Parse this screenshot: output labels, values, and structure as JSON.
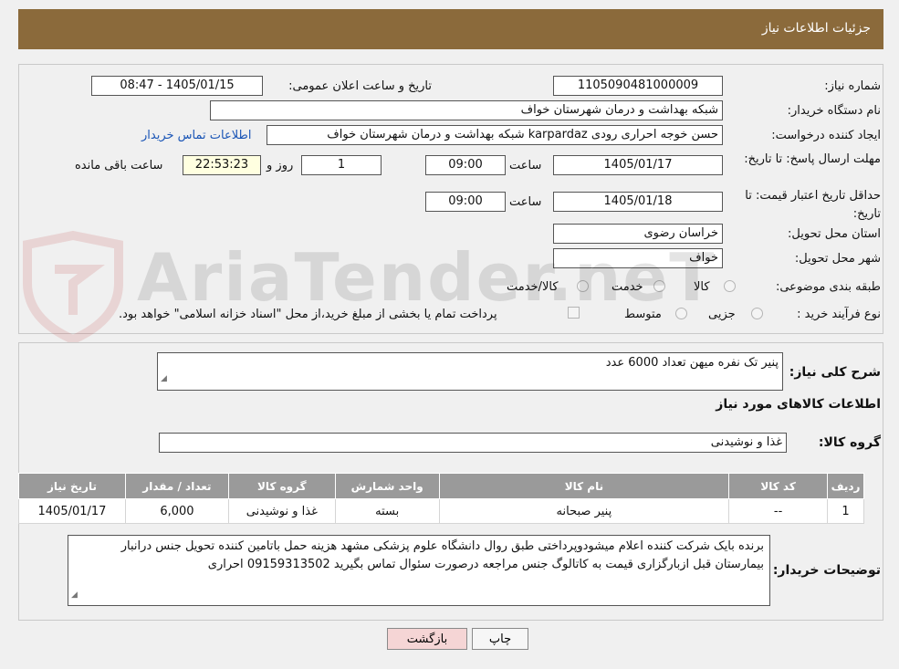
{
  "header": {
    "title": "جزئیات اطلاعات نیاز"
  },
  "form": {
    "need_number_label": "شماره نیاز:",
    "need_number": "1105090481000009",
    "announce_label": "تاریخ و ساعت اعلان عمومی:",
    "announce_value": "1405/01/15 - 08:47",
    "buyer_org_label": "نام دستگاه خریدار:",
    "buyer_org": "شبکه بهداشت و درمان شهرستان خواف",
    "creator_label": "ایجاد کننده درخواست:",
    "creator": "حسن خوجه احراری رودی karpardaz شبکه بهداشت و درمان شهرستان خواف",
    "contact_link": "اطلاعات تماس خریدار",
    "deadline_label": "مهلت ارسال پاسخ: تا تاریخ:",
    "deadline_date": "1405/01/17",
    "time_label": "ساعت",
    "deadline_time": "09:00",
    "days_value": "1",
    "days_label": "روز و",
    "remaining_time": "22:53:23",
    "remaining_label": "ساعت باقی مانده",
    "validity_label": "حداقل تاریخ اعتبار قیمت: تا تاریخ:",
    "validity_date": "1405/01/18",
    "validity_time": "09:00",
    "province_label": "استان محل تحویل:",
    "province": "خراسان رضوی",
    "city_label": "شهر محل تحویل:",
    "city": "خواف",
    "category_label": "طبقه بندی موضوعی:",
    "category_options": [
      "کالا",
      "خدمت",
      "کالا/خدمت"
    ],
    "category_selected": "کالا",
    "process_label": "نوع فرآیند خرید :",
    "process_options": [
      "جزیی",
      "متوسط"
    ],
    "payment_note": "پرداخت تمام یا بخشی از مبلغ خرید،از محل \"اسناد خزانه اسلامی\" خواهد بود."
  },
  "description": {
    "label": "شرح کلی نیاز:",
    "value": "پنیر تک نفره میهن تعداد 6000 عدد"
  },
  "goods": {
    "section_title": "اطلاعات کالاهای مورد نیاز",
    "group_label": "گروه کالا:",
    "group_value": "غذا و نوشیدنی",
    "columns": [
      "ردیف",
      "کد کالا",
      "نام کالا",
      "واحد شمارش",
      "گروه کالا",
      "تعداد / مقدار",
      "تاریخ نیاز"
    ],
    "rows": [
      [
        "1",
        "--",
        "پنیر صبحانه",
        "بسته",
        "غذا و نوشیدنی",
        "6,000",
        "1405/01/17"
      ]
    ]
  },
  "buyer_notes": {
    "label": "توضیحات خریدار:",
    "value": "برنده بایک شرکت کننده اعلام میشودوپرداختی طبق روال دانشگاه علوم پزشکی مشهد هزینه حمل باتامین کننده تحویل جنس درانبار بیمارستان قبل ازبارگزاری قیمت به کاتالوگ جنس مراجعه درصورت سئوال تماس بگیرید 09159313502 احراری"
  },
  "buttons": {
    "print": "چاپ",
    "back": "بازگشت"
  },
  "watermark": {
    "text": "AriaTender.neT"
  },
  "colors": {
    "header_bg": "#8b6a3b",
    "link": "#1a55b6",
    "back_button_bg": "#f5d5d5"
  }
}
